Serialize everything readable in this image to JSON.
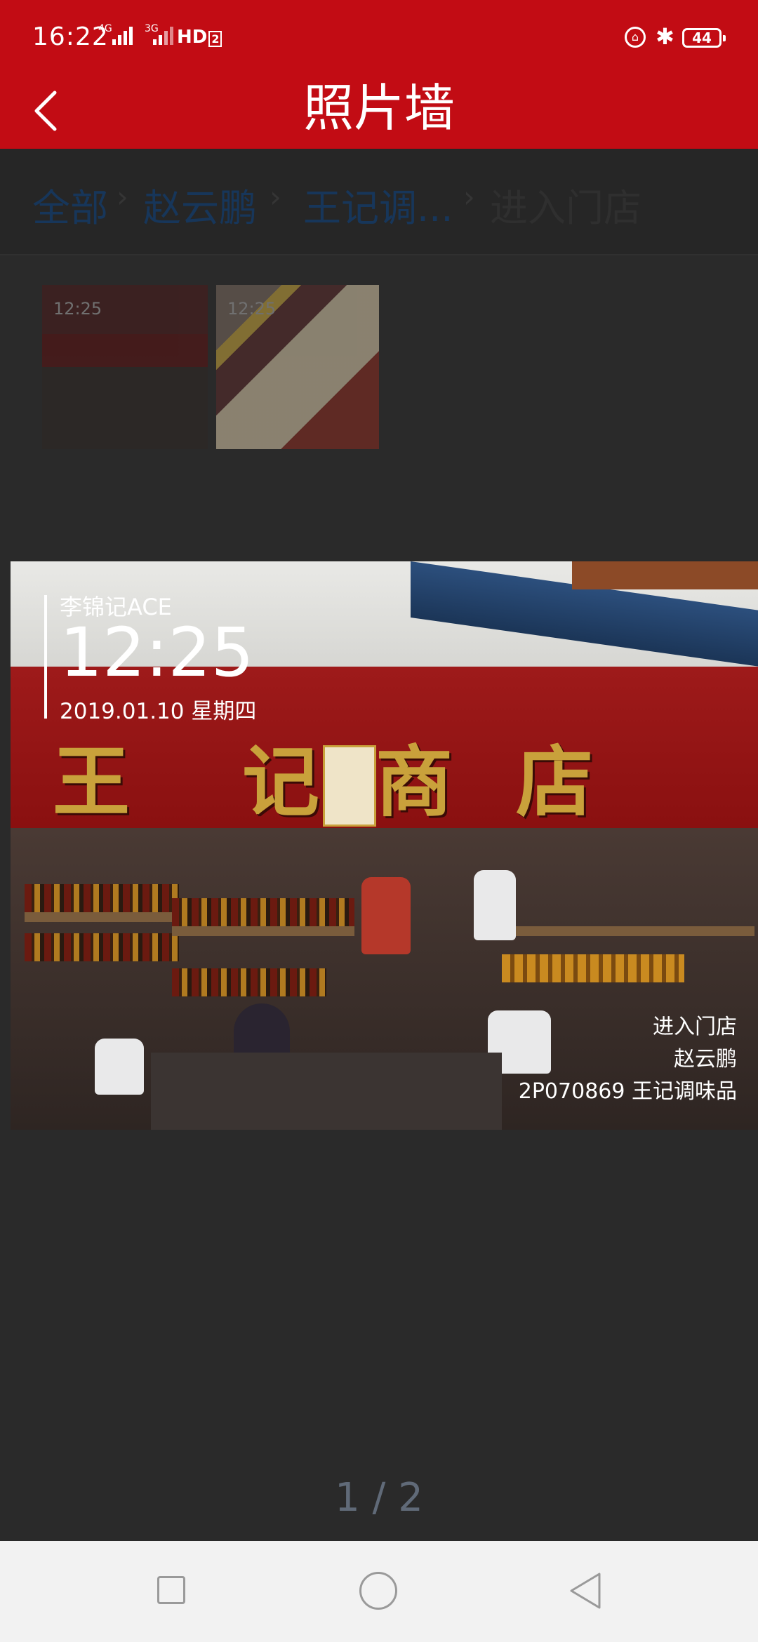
{
  "status": {
    "time": "16:22",
    "sig1": "4G",
    "sig2": "3G",
    "hd": "HD",
    "hd_sub": "2",
    "battery": "44"
  },
  "header": {
    "title": "照片墙"
  },
  "breadcrumb": {
    "items": [
      "全部",
      "赵云鹏",
      "王记调...",
      "进入门店"
    ]
  },
  "thumbnails": [
    {
      "time": "12:25"
    },
    {
      "time": "12:25"
    }
  ],
  "photo": {
    "sign_chars": [
      "王",
      "记",
      "商",
      "店"
    ],
    "watermark": {
      "name": "李锦记ACE",
      "time": "12:25",
      "date": "2019.01.10 星期四",
      "action": "进入门店",
      "person": "赵云鹏",
      "store": "2P070869 王记调味品"
    }
  },
  "pager": {
    "text": "1 / 2"
  },
  "colors": {
    "header": "#c20c14",
    "overlay": "#2a2a2a",
    "nav": "#f2f2f2"
  }
}
